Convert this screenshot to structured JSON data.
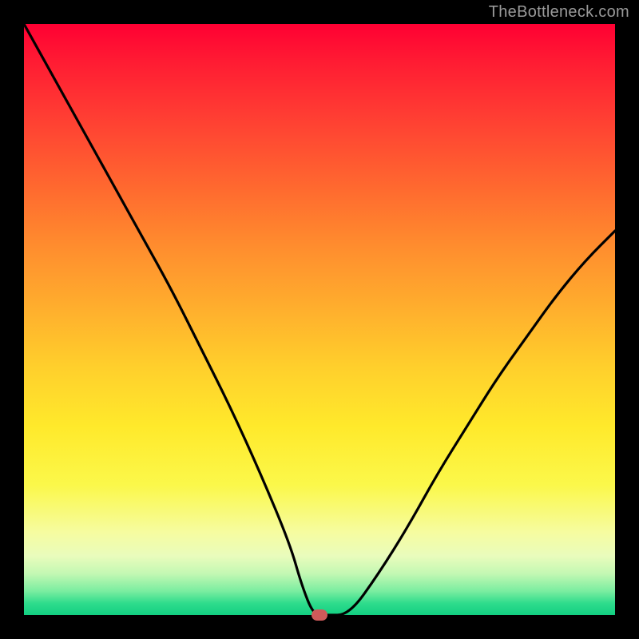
{
  "watermark": "TheBottleneck.com",
  "chart_data": {
    "type": "line",
    "title": "",
    "xlabel": "",
    "ylabel": "",
    "xlim": [
      0,
      100
    ],
    "ylim": [
      0,
      100
    ],
    "grid": false,
    "legend": false,
    "series": [
      {
        "name": "curve",
        "x": [
          0,
          5,
          10,
          15,
          20,
          25,
          30,
          35,
          40,
          45,
          47,
          49,
          51,
          55,
          60,
          65,
          70,
          75,
          80,
          85,
          90,
          95,
          100
        ],
        "values": [
          100,
          91,
          82,
          73,
          64,
          55,
          45,
          35,
          24,
          12,
          5,
          0,
          0,
          0,
          7,
          15,
          24,
          32,
          40,
          47,
          54,
          60,
          65
        ]
      }
    ],
    "marker": {
      "x": 50,
      "y": 0,
      "color": "#cf5a5a"
    },
    "background_gradient": {
      "stops": [
        {
          "pos": 0,
          "color": "#ff0033"
        },
        {
          "pos": 50,
          "color": "#ffb82d"
        },
        {
          "pos": 80,
          "color": "#f6fca0"
        },
        {
          "pos": 100,
          "color": "#12cf82"
        }
      ]
    }
  }
}
